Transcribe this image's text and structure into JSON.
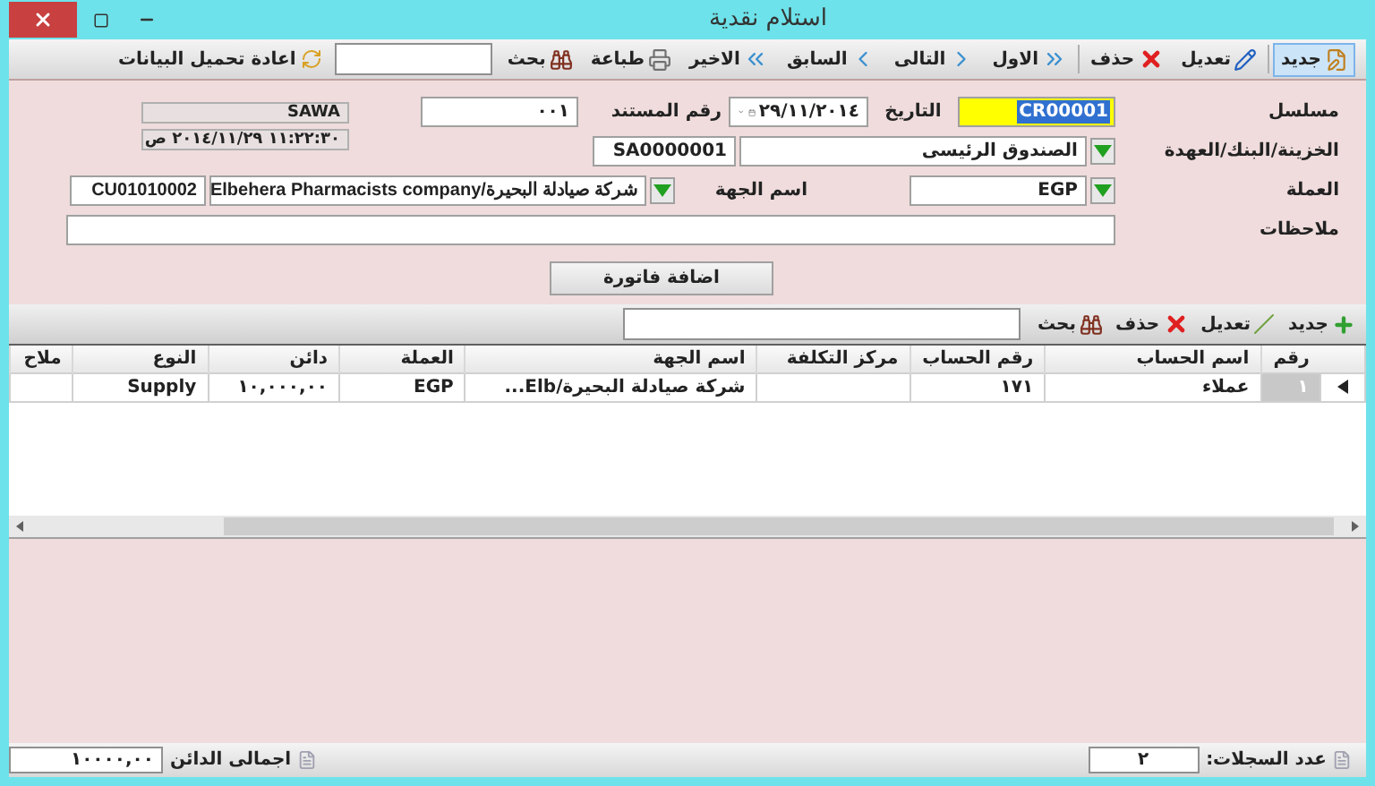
{
  "window": {
    "title": "استلام نقدية"
  },
  "toolbar": {
    "items": [
      {
        "label": "جديد",
        "kind": "new",
        "selected": true
      },
      {
        "label": "تعديل",
        "kind": "edit",
        "selected": false
      },
      {
        "label": "حذف",
        "kind": "delete",
        "selected": false
      },
      {
        "label": "الاول",
        "kind": "first",
        "selected": false
      },
      {
        "label": "التالى",
        "kind": "next",
        "selected": false
      },
      {
        "label": "السابق",
        "kind": "prev",
        "selected": false
      },
      {
        "label": "الاخير",
        "kind": "last",
        "selected": false
      },
      {
        "label": "طباعة",
        "kind": "print",
        "selected": false
      },
      {
        "label": "بحث",
        "kind": "search",
        "selected": false
      }
    ],
    "reload": "اعادة تحميل البيانات"
  },
  "form": {
    "serial_label": "مسلسل",
    "serial": "CR00001",
    "date_label": "التاريخ",
    "date": "٢٩/١١/٢٠١٤",
    "doc_no_label": "رقم المستند",
    "doc_no": "٠٠١",
    "user": "SAWA",
    "treasury_label": "الخزينة/البنك/العهدة",
    "treasury": "الصندوق الرئيسى",
    "treasury_code": "SA0000001",
    "timestamp": "١١:٢٢:٣٠ ٢٠١٤/١١/٢٩ ص",
    "currency_label": "العملة",
    "currency": "EGP",
    "party_label": "اسم الجهة",
    "party": "شركة صيادلة البحيرة/Elbehera Pharmacists company",
    "party_code": "CU01010002",
    "notes_label": "ملاحظات",
    "add_invoice": "اضافة فاتورة"
  },
  "detail_toolbar": {
    "items": [
      {
        "label": "جديد",
        "kind": "add"
      },
      {
        "label": "تعديل",
        "kind": "edit"
      },
      {
        "label": "حذف",
        "kind": "delete"
      },
      {
        "label": "بحث",
        "kind": "search"
      }
    ]
  },
  "table": {
    "columns": [
      "رقم",
      "اسم الحساب",
      "رقم الحساب",
      "مركز التكلفة",
      "اسم الجهة",
      "العملة",
      "دائن",
      "النوع",
      "ملاح"
    ],
    "rows": [
      {
        "selected": true,
        "cells": [
          "١",
          "عملاء",
          "١٧١",
          "",
          "شركة صيادلة البحيرة/Elb...",
          "EGP",
          "١٠,٠٠٠,٠٠",
          "Supply",
          ""
        ]
      }
    ]
  },
  "status_bar": {
    "count_label": "عدد السجلات:",
    "count": "٢",
    "total_label": "اجمالى الدائن",
    "total": "١٠٠٠٠,٠٠"
  }
}
